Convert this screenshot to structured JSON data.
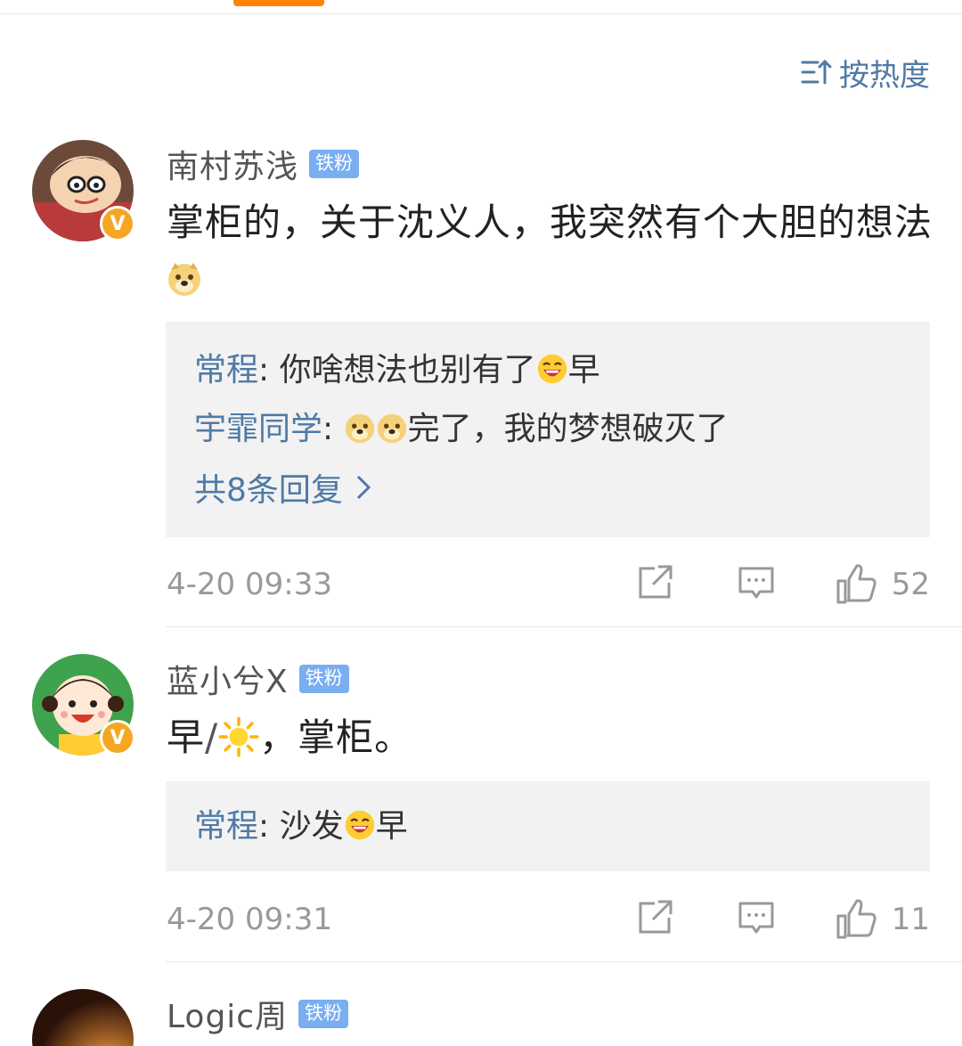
{
  "sort": {
    "label": "按热度"
  },
  "comments": [
    {
      "username": "南村苏浅",
      "badge": "铁粉",
      "text_before_emoji": "掌柜的，关于沈义人，我突然有个大胆的想法",
      "replies": [
        {
          "name": "常程",
          "sep": ": ",
          "text1": "你啥想法也别有了",
          "text2": "早"
        },
        {
          "name": "宇霏同学",
          "sep": ": ",
          "text1": "",
          "text2": "完了，我的梦想破灭了"
        }
      ],
      "more_replies": "共8条回复",
      "time": "4-20 09:33",
      "likes": "52"
    },
    {
      "username": "蓝小兮X",
      "badge": "铁粉",
      "text_a": "早",
      "text_b": "，掌柜。",
      "replies": [
        {
          "name": "常程",
          "sep": ": ",
          "text1": "沙发",
          "text2": "早"
        }
      ],
      "time": "4-20 09:31",
      "likes": "11"
    },
    {
      "username": "Logic周",
      "badge": "铁粉"
    }
  ],
  "colors": {
    "accent": "#ff8200",
    "link": "#4f7aa6",
    "badge": "#79aef0",
    "verified": "#f5a623"
  }
}
